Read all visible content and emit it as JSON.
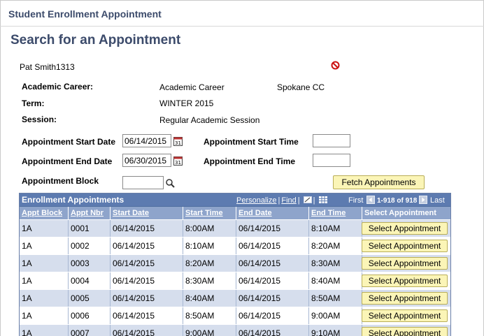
{
  "app_title": "Student Enrollment Appointment",
  "page_title": "Search for an Appointment",
  "student_name": "Pat Smith1313",
  "career": {
    "label": "Academic Career:",
    "value": "Academic Career",
    "institution": "Spokane CC"
  },
  "term": {
    "label": "Term:",
    "value": "WINTER 2015"
  },
  "session": {
    "label": "Session:",
    "value": "Regular Academic Session"
  },
  "appt_start_date": {
    "label": "Appointment Start Date",
    "value": "06/14/2015"
  },
  "appt_end_date": {
    "label": "Appointment End Date",
    "value": "06/30/2015"
  },
  "appt_start_time": {
    "label": "Appointment Start Time",
    "value": ""
  },
  "appt_end_time": {
    "label": "Appointment End Time",
    "value": ""
  },
  "appt_block": {
    "label": "Appointment Block",
    "value": ""
  },
  "fetch_button": "Fetch Appointments",
  "grid": {
    "title": "Enrollment Appointments",
    "personalize": "Personalize",
    "find": "Find",
    "nav_first": "First",
    "nav_range": "1-918 of 918",
    "nav_last": "Last",
    "columns": [
      "Appt Block",
      "Appt Nbr",
      "Start Date",
      "Start Time",
      "End Date",
      "End Time",
      "Select Appointment"
    ],
    "rows": [
      {
        "block": "1A",
        "nbr": "0001",
        "start_date": "06/14/2015",
        "start_time": "8:00AM",
        "end_date": "06/14/2015",
        "end_time": "8:10AM"
      },
      {
        "block": "1A",
        "nbr": "0002",
        "start_date": "06/14/2015",
        "start_time": "8:10AM",
        "end_date": "06/14/2015",
        "end_time": "8:20AM"
      },
      {
        "block": "1A",
        "nbr": "0003",
        "start_date": "06/14/2015",
        "start_time": "8:20AM",
        "end_date": "06/14/2015",
        "end_time": "8:30AM"
      },
      {
        "block": "1A",
        "nbr": "0004",
        "start_date": "06/14/2015",
        "start_time": "8:30AM",
        "end_date": "06/14/2015",
        "end_time": "8:40AM"
      },
      {
        "block": "1A",
        "nbr": "0005",
        "start_date": "06/14/2015",
        "start_time": "8:40AM",
        "end_date": "06/14/2015",
        "end_time": "8:50AM"
      },
      {
        "block": "1A",
        "nbr": "0006",
        "start_date": "06/14/2015",
        "start_time": "8:50AM",
        "end_date": "06/14/2015",
        "end_time": "9:00AM"
      },
      {
        "block": "1A",
        "nbr": "0007",
        "start_date": "06/14/2015",
        "start_time": "9:00AM",
        "end_date": "06/14/2015",
        "end_time": "9:10AM"
      }
    ],
    "select_label": "Select Appointment"
  },
  "colors": {
    "title": "#3c4b6b",
    "grid_header": "#5d7bb0",
    "column_header": "#8ea4cb",
    "row_alt": "#d6deed",
    "button": "#fbf5b7"
  }
}
